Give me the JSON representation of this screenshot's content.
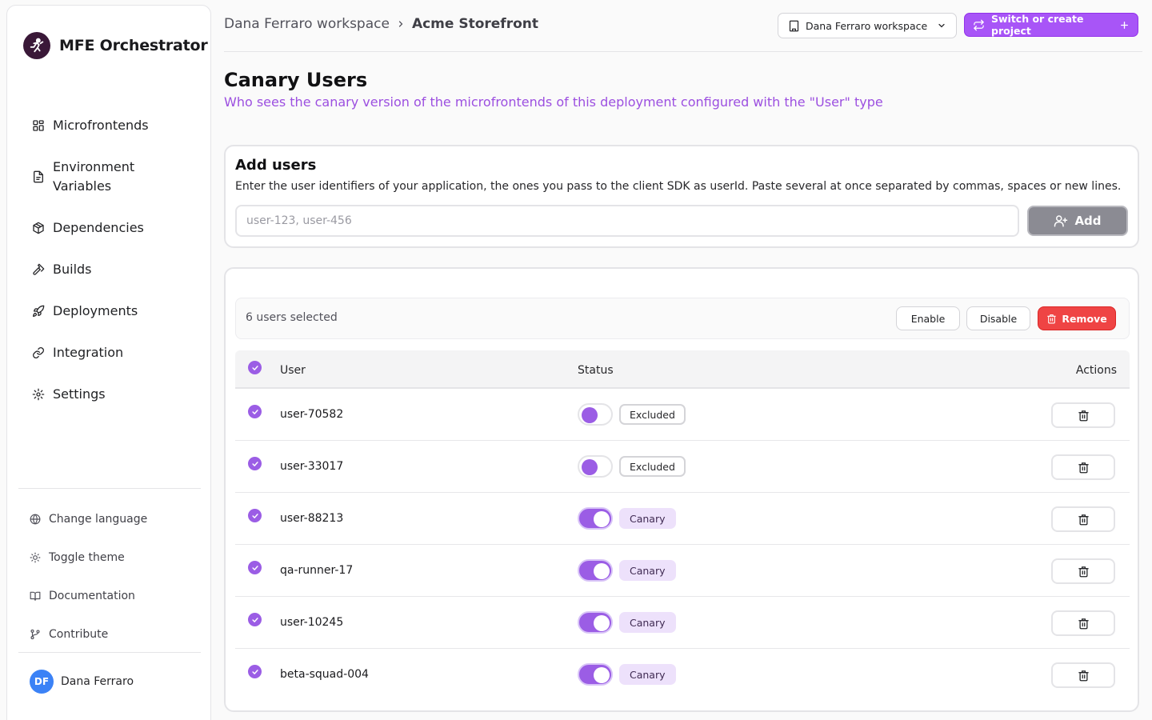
{
  "sidebar": {
    "brand": "MFE Orchestrator",
    "nav": [
      {
        "label": "Microfrontends",
        "icon": "grid-icon"
      },
      {
        "label": "Environment Variables",
        "icon": "file-text-icon"
      },
      {
        "label": "Dependencies",
        "icon": "package-icon"
      },
      {
        "label": "Builds",
        "icon": "hammer-icon"
      },
      {
        "label": "Deployments",
        "icon": "rocket-icon"
      },
      {
        "label": "Integration",
        "icon": "link-icon"
      },
      {
        "label": "Settings",
        "icon": "gear-icon"
      }
    ],
    "utilities": [
      {
        "label": "Change language",
        "icon": "globe-icon"
      },
      {
        "label": "Toggle theme",
        "icon": "sun-icon"
      },
      {
        "label": "Documentation",
        "icon": "book-icon"
      },
      {
        "label": "Contribute",
        "icon": "git-branch-icon"
      }
    ],
    "user": {
      "initials": "DF",
      "name": "Dana Ferraro"
    }
  },
  "header": {
    "breadcrumb": {
      "workspace": "Dana Ferraro workspace",
      "project": "Acme Storefront"
    },
    "workspace_select": "Dana Ferraro workspace",
    "project_button": "Switch or create project"
  },
  "page": {
    "title": "Canary Users",
    "subtitle": "Who sees the canary version of the microfrontends of this deployment configured with the \"User\" type"
  },
  "add_users": {
    "title": "Add users",
    "description": "Enter the user identifiers of your application, the ones you pass to the client SDK as userId. Paste several at once separated by commas, spaces or new lines.",
    "placeholder": "user-123, user-456",
    "value": "",
    "button": "Add"
  },
  "selection": {
    "text": "6 users selected",
    "enable": "Enable",
    "disable": "Disable",
    "remove": "Remove"
  },
  "table": {
    "columns": {
      "user": "User",
      "status": "Status",
      "actions": "Actions"
    },
    "rows": [
      {
        "user": "user-70582",
        "status": "Excluded",
        "enabled": false,
        "selected": true
      },
      {
        "user": "user-33017",
        "status": "Excluded",
        "enabled": false,
        "selected": true
      },
      {
        "user": "user-88213",
        "status": "Canary",
        "enabled": true,
        "selected": true
      },
      {
        "user": "qa-runner-17",
        "status": "Canary",
        "enabled": true,
        "selected": true
      },
      {
        "user": "user-10245",
        "status": "Canary",
        "enabled": true,
        "selected": true
      },
      {
        "user": "beta-squad-004",
        "status": "Canary",
        "enabled": true,
        "selected": true
      }
    ]
  },
  "colors": {
    "accent": "#9b5de5",
    "primary_button": "#a855f7",
    "danger": "#ef4444",
    "subtitle": "#9c4fe0"
  }
}
